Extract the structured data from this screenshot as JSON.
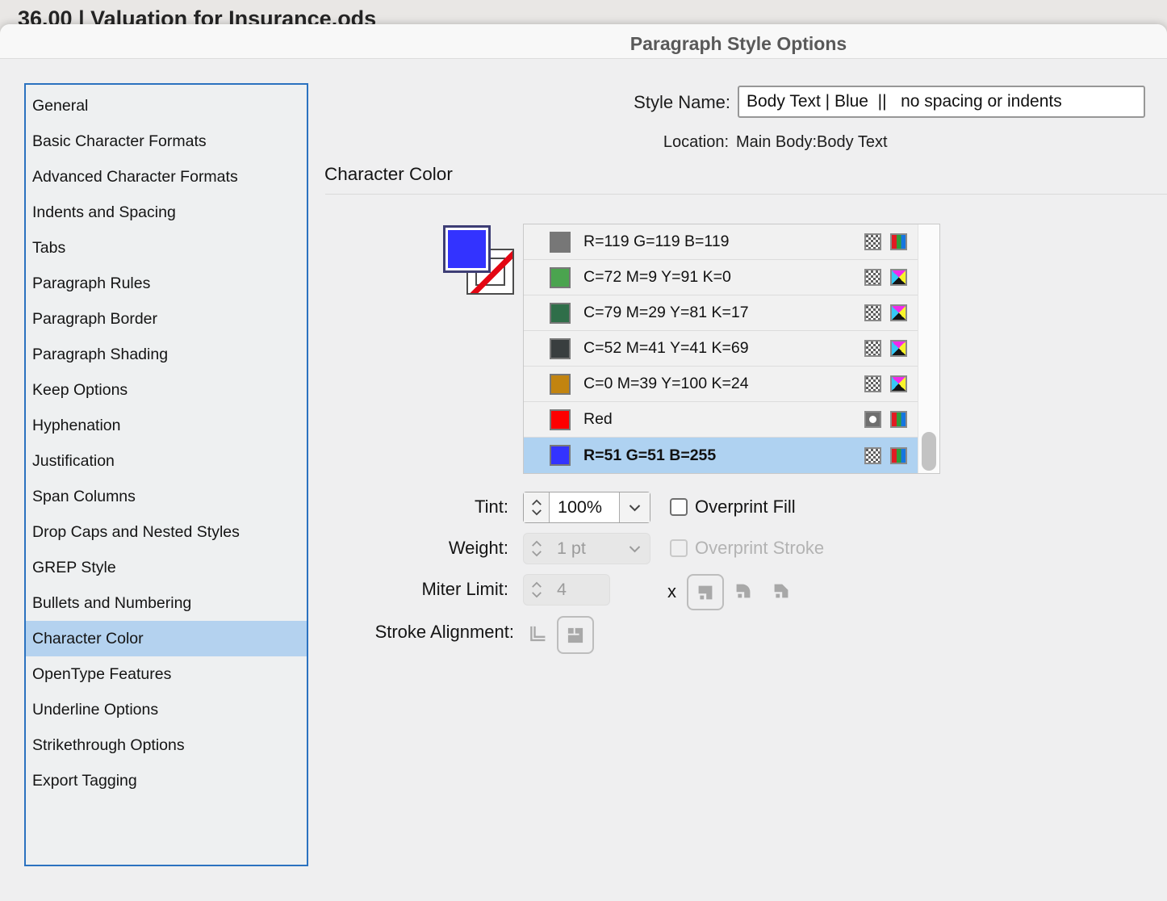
{
  "background_window": {
    "title": "36.00 | Valuation for Insurance.ods"
  },
  "dialog": {
    "title": "Paragraph Style Options",
    "style_name": {
      "label": "Style Name:",
      "value": "Body Text | Blue  ||   no spacing or indents"
    },
    "location": {
      "label": "Location:",
      "value": "Main Body:Body Text"
    },
    "section": {
      "title": "Character Color"
    }
  },
  "sidebar": {
    "items": [
      {
        "label": "General",
        "selected": false
      },
      {
        "label": "Basic Character Formats",
        "selected": false
      },
      {
        "label": "Advanced Character Formats",
        "selected": false
      },
      {
        "label": "Indents and Spacing",
        "selected": false
      },
      {
        "label": "Tabs",
        "selected": false
      },
      {
        "label": "Paragraph Rules",
        "selected": false
      },
      {
        "label": "Paragraph Border",
        "selected": false
      },
      {
        "label": "Paragraph Shading",
        "selected": false
      },
      {
        "label": "Keep Options",
        "selected": false
      },
      {
        "label": "Hyphenation",
        "selected": false
      },
      {
        "label": "Justification",
        "selected": false
      },
      {
        "label": "Span Columns",
        "selected": false
      },
      {
        "label": "Drop Caps and Nested Styles",
        "selected": false
      },
      {
        "label": "GREP Style",
        "selected": false
      },
      {
        "label": "Bullets and Numbering",
        "selected": false
      },
      {
        "label": "Character Color",
        "selected": true
      },
      {
        "label": "OpenType Features",
        "selected": false
      },
      {
        "label": "Underline Options",
        "selected": false
      },
      {
        "label": "Strikethrough Options",
        "selected": false
      },
      {
        "label": "Export Tagging",
        "selected": false
      }
    ]
  },
  "swatch_list": {
    "rows": [
      {
        "name": "R=119 G=119 B=119",
        "color": "#777777",
        "left_icon": "checker",
        "mode_icon": "rgb",
        "selected": false
      },
      {
        "name": "C=72 M=9 Y=91 K=0",
        "color": "#4ba44f",
        "left_icon": "checker",
        "mode_icon": "cmyk",
        "selected": false
      },
      {
        "name": "C=79 M=29 Y=81 K=17",
        "color": "#2f6e49",
        "left_icon": "checker",
        "mode_icon": "cmyk",
        "selected": false
      },
      {
        "name": "C=52 M=41 Y=41 K=69",
        "color": "#393e3f",
        "left_icon": "checker",
        "mode_icon": "cmyk",
        "selected": false
      },
      {
        "name": "C=0 M=39 Y=100 K=24",
        "color": "#c28410",
        "left_icon": "checker",
        "mode_icon": "cmyk",
        "selected": false
      },
      {
        "name": "Red",
        "color": "#fe0000",
        "left_icon": "spot",
        "mode_icon": "rgb",
        "selected": false
      },
      {
        "name": "R=51 G=51 B=255",
        "color": "#3333ff",
        "left_icon": "checker",
        "mode_icon": "rgb",
        "selected": true
      }
    ]
  },
  "controls": {
    "tint": {
      "label": "Tint:",
      "value": "100%"
    },
    "weight": {
      "label": "Weight:",
      "value": "1 pt",
      "disabled": true
    },
    "miter_limit": {
      "label": "Miter Limit:",
      "value": "4",
      "suffix": "x",
      "disabled": true
    },
    "stroke_alignment": {
      "label": "Stroke Alignment:"
    },
    "overprint_fill": {
      "label": "Overprint Fill",
      "checked": false
    },
    "overprint_stroke": {
      "label": "Overprint Stroke",
      "checked": false,
      "disabled": true
    }
  },
  "colors": {
    "selection_blue": "#afd2f1",
    "sidebar_border": "#2b72c0",
    "fill_proxy_blue": "#3333ff",
    "none_indicator_red": "#e30613"
  }
}
